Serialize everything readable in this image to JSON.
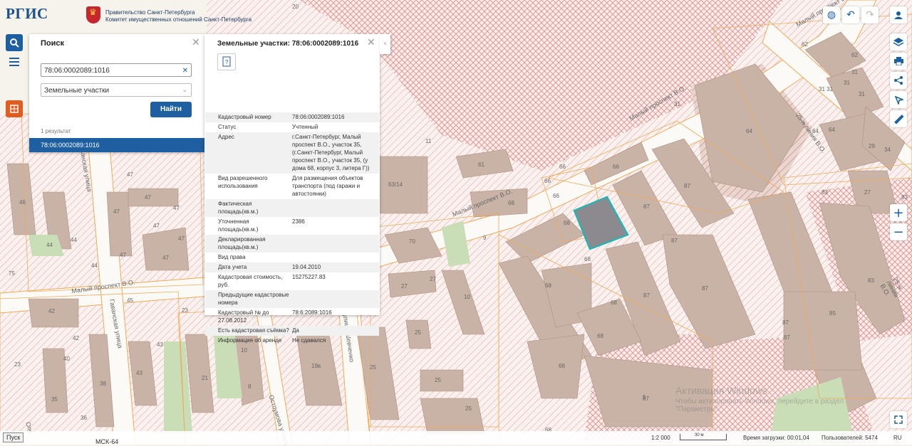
{
  "header": {
    "logo_text": "РГИС",
    "gov_line1": "Правительство Санкт-Петербурга",
    "gov_line2": "Комитет имущественных отношений Санкт-Петербурга"
  },
  "left_toolbar": {
    "icons": [
      "search-icon",
      "menu-icon",
      "layers-special-icon"
    ]
  },
  "right_toolbar": {
    "icons": [
      "globe-icon",
      "undo-icon",
      "redo-icon",
      "user-icon",
      "layers-icon",
      "print-icon",
      "share-icon",
      "select-icon",
      "ruler-icon",
      "zoom-in-icon",
      "zoom-out-icon",
      "fullscreen-icon"
    ]
  },
  "search_panel": {
    "title": "Поиск",
    "query": "78:06:0002089:1016",
    "category": "Земельные участки",
    "find_label": "Найти",
    "result_count": "1 результат",
    "result_item": "78:06:0002089:1016"
  },
  "info_panel": {
    "title": "Земельные участки: 78:06:0002089:1016",
    "rows": [
      {
        "label": "Кадастровый номер",
        "value": "78:06:0002089:1016"
      },
      {
        "label": "Статус",
        "value": "Учтенный"
      },
      {
        "label": "Адрес",
        "value": "г.Санкт-Петербург, Малый проспект В.О., участок 35, (г.Санкт-Петербург, Малый проспект В.О., участок 35, (у дома 68, корпус 3, литера Г))"
      },
      {
        "label": "Вид разрешенного использования",
        "value": "Для размещения объектов транспорта (под гаражи и автостоянки)"
      },
      {
        "label": "Фактическая площадь(кв.м.)",
        "value": ""
      },
      {
        "label": "Уточненная площадь(кв.м.)",
        "value": "2386"
      },
      {
        "label": "Декларированная площадь(кв.м.)",
        "value": ""
      },
      {
        "label": "Вид права",
        "value": ""
      },
      {
        "label": "Дата учета",
        "value": "19.04.2010"
      },
      {
        "label": "Кадастровая стоимость, руб.",
        "value": "15275227.83"
      },
      {
        "label": "Предыдущие кадастровые номера",
        "value": ""
      },
      {
        "label": "Кадастровый № до 27.08.2012",
        "value": "78:6:2089:1016"
      },
      {
        "label": "Есть кадастровая съёмка?",
        "value": "Да"
      },
      {
        "label": "Информация об аренде",
        "value": "Не сдавался"
      }
    ]
  },
  "map": {
    "streets": [
      "Малый проспект В.О.",
      "Малый проспект В.О.",
      "Малый проспект В.О.",
      "Малый проспект В.О.",
      "25-я линия В.О.",
      "25-я линия В.О.",
      "Гаванская улица",
      "Гаванская улица",
      "улица Шевченко",
      "Остоумова улица",
      "Опо..."
    ],
    "labels": [
      "20",
      "62",
      "62",
      "31",
      "31",
      "31 31",
      "31",
      "31",
      "64",
      "64",
      "64",
      "11",
      "61",
      "66",
      "66",
      "66",
      "66",
      "63/14",
      "68",
      "68",
      "87",
      "87",
      "87",
      "87",
      "87",
      "87",
      "87",
      "87",
      "9",
      "70",
      "27",
      "27",
      "10",
      "25",
      "25",
      "25",
      "25",
      "19в",
      "21",
      "8",
      "10",
      "43",
      "43",
      "38",
      "42",
      "42",
      "40",
      "23",
      "23",
      "45",
      "47",
      "47",
      "47",
      "47",
      "47",
      "47",
      "47",
      "47",
      "44",
      "44",
      "44",
      "46",
      "75",
      "35",
      "36",
      "5",
      "68",
      "68",
      "68",
      "68",
      "68",
      "68",
      "85",
      "83",
      "83",
      "83",
      "29",
      "27",
      "34",
      "29",
      "24",
      "21",
      "8"
    ],
    "watermark_line1": "Активация Windows",
    "watermark_line2": "Чтобы активировать Windows, перейдите в раздел",
    "watermark_line3": "\"Параметры\"."
  },
  "bottom_bar": {
    "start_label": "Пуск",
    "projection": "МСК-64",
    "scale": "1:2 000",
    "scale_bar": "30 м",
    "load_time": "Время загрузки: 00:01,04",
    "users": "Пользователей: 5474",
    "lang": "RU"
  }
}
